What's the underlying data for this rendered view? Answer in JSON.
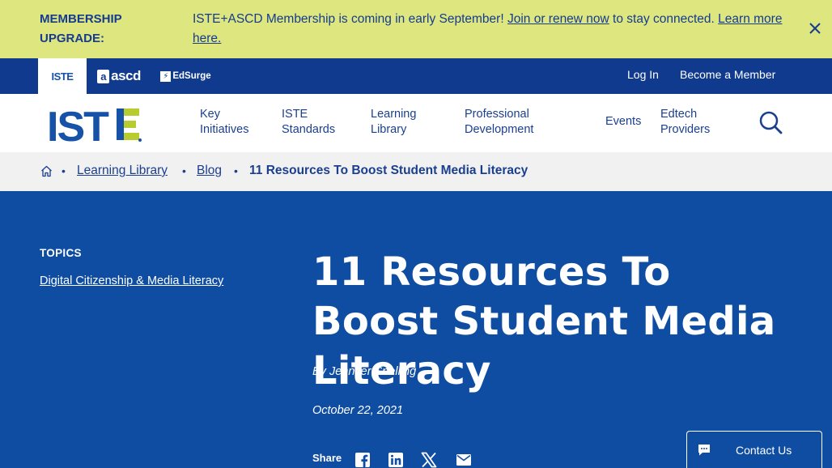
{
  "banner": {
    "label": "MEMBERSHIP UPGRADE:",
    "message_prefix": "ISTE+ASCD Membership is coming in early September! ",
    "link1": "Join or renew now",
    "message_mid": " to stay connected. ",
    "link2": "Learn more here.",
    "close_icon": "close-icon"
  },
  "brands": {
    "iste": "ISTE",
    "ascd": "ascd",
    "edsurge": "EdSurge"
  },
  "utility": {
    "login": "Log In",
    "become_member": "Become a Member"
  },
  "logo": {
    "text": "ISTE"
  },
  "nav": {
    "items": [
      {
        "line1": "Key",
        "line2": "Initiatives"
      },
      {
        "line1": "ISTE",
        "line2": "Standards"
      },
      {
        "line1": "Learning",
        "line2": "Library"
      },
      {
        "line1": "Professional",
        "line2": "Development"
      },
      {
        "line1": "Events",
        "line2": ""
      },
      {
        "line1": "Edtech",
        "line2": "Providers"
      }
    ],
    "search_icon": "search-icon"
  },
  "breadcrumb": {
    "home_icon": "home-icon",
    "items": [
      "Learning Library",
      "Blog"
    ],
    "current": "11 Resources To Boost Student Media Literacy"
  },
  "sidebar": {
    "topics_label": "TOPICS",
    "topic": "Digital Citizenship & Media Literacy"
  },
  "article": {
    "title": "11 Resources To Boost Student Media Literacy",
    "byline": "By Jennifer Snelling",
    "date": "October 22, 2021",
    "share_label": "Share",
    "share_icons": [
      "facebook-icon",
      "linkedin-icon",
      "x-icon",
      "email-icon"
    ]
  },
  "contact": {
    "label": "Contact Us",
    "icon": "chat-icon"
  },
  "colors": {
    "banner_bg": "#dde67f",
    "brandbar_bg": "#103a8e",
    "page_bg": "#0f4da2",
    "accent_green": "#b9cc2f",
    "nav_text": "#1b3f8f"
  }
}
